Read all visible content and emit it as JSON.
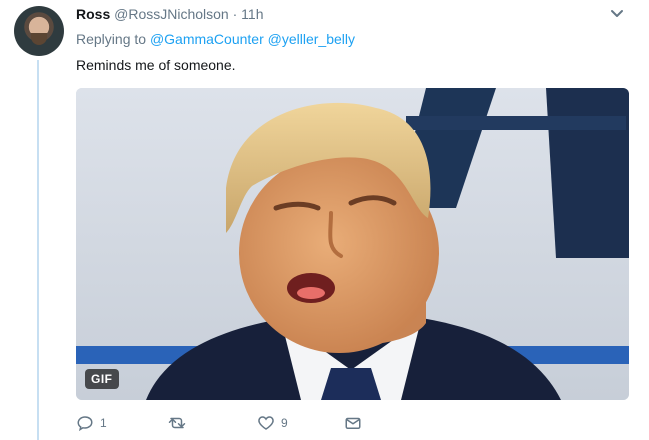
{
  "tweet": {
    "name": "Ross",
    "handle": "@RossJNicholson",
    "separator": "·",
    "time": "11h",
    "replying_prefix": "Replying to",
    "mentions": [
      "@GammaCounter",
      "@yelller_belly"
    ],
    "text": "Reminds me of someone.",
    "media_badge": "GIF"
  },
  "actions": {
    "reply_count": "1",
    "retweet_count": "",
    "like_count": "9"
  },
  "icons": [
    "avatar",
    "chevron-down-icon",
    "reply-icon",
    "retweet-icon",
    "like-icon",
    "message-icon"
  ],
  "colors": {
    "link": "#1da1f2",
    "muted": "#657786",
    "thread_line": "#c7dff2"
  }
}
